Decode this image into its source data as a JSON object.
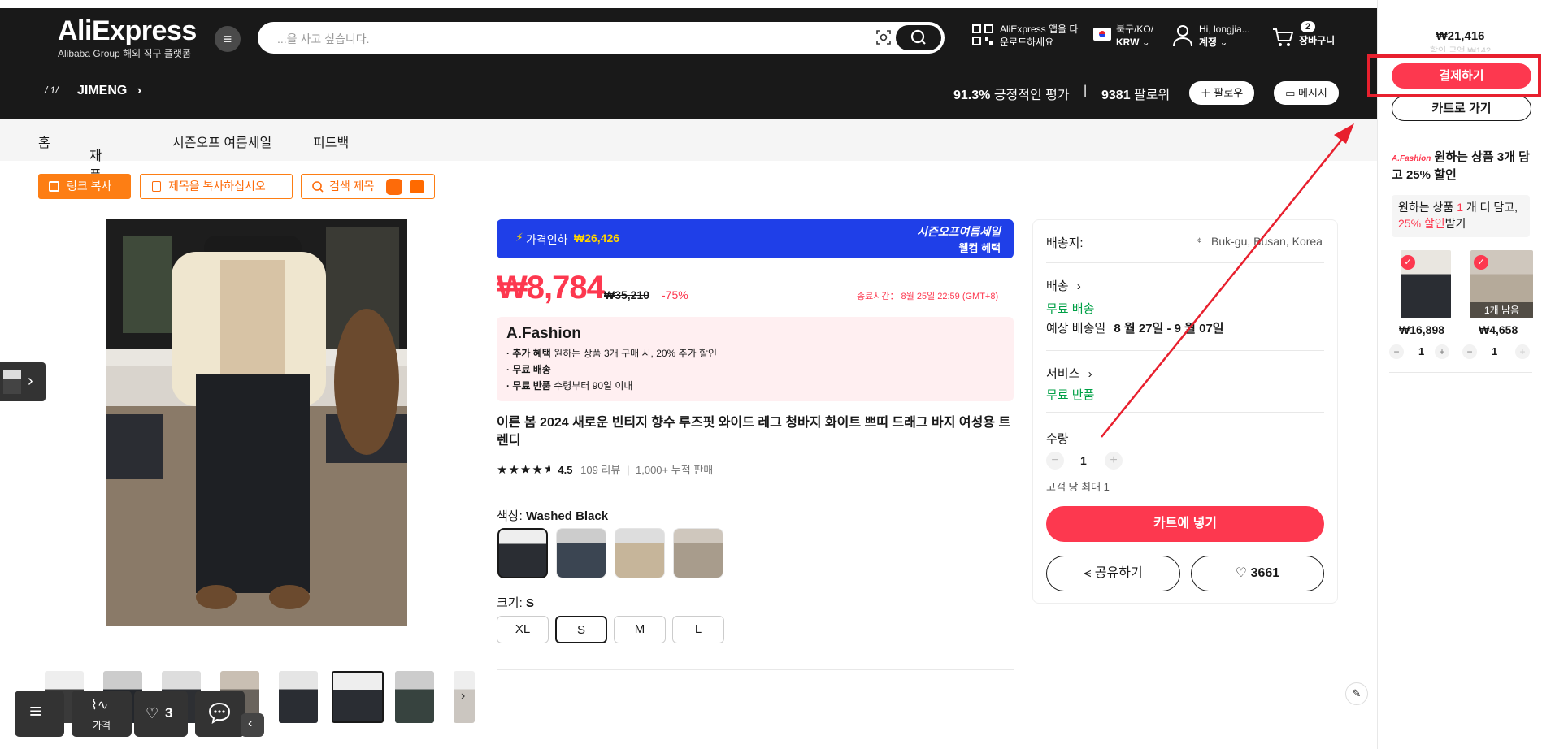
{
  "header": {
    "logo_main": "AliExpress",
    "logo_sub": "Alibaba Group 해외 직구 플랫폼",
    "search_placeholder": "...을 사고 싶습니다.",
    "app_line1": "AliExpress 앱을 다",
    "app_line2": "운로드하세요",
    "region_line1": "북구/KO/",
    "region_line2": "KRW",
    "account_line1": "Hi, longjia...",
    "account_line2": "계정",
    "cart_count": "2",
    "cart_label": "장바구니"
  },
  "store": {
    "name": "JIMENG",
    "logo_text": "/ 1/",
    "positive_rate": "91.3%",
    "positive_label": "긍정적인 평가",
    "separator": "|",
    "followers": "9381",
    "followers_label": "팔로워",
    "follow_btn": "팔로우",
    "message_btn": "메시지"
  },
  "nav": {
    "home": "홈",
    "products": "제품",
    "sale": "시즌오프 여름세일",
    "feedback": "피드백"
  },
  "tools": {
    "copy_link": "링크 복사",
    "copy_title": "제목을 복사하십시오",
    "search_title": "검색 제목"
  },
  "promo": {
    "price_drop_label": "가격인하",
    "price_drop_value": "₩26,426",
    "season_title": "시즌오프여름세일",
    "welcome": "웰컴 혜택"
  },
  "product": {
    "price": "₩8,784",
    "old_price": "₩35,210",
    "discount": "-75%",
    "end_time": "종료시간：  8월 25일 22:59 (GMT+8)",
    "fashion_brand": "A.Fashion",
    "benefit1_prefix": "· 추가 혜택",
    "benefit1_text": "원하는 상품 3개 구매 시, 20% 추가 할인",
    "benefit2_prefix": "· 무료 배송",
    "benefit3_prefix": "· 무료 반품",
    "benefit3_text": "수령부터 90일 이내",
    "title": "이른 봄 2024 새로운 빈티지 향수 루즈핏 와이드 레그 청바지 화이트 쁘띠 드래그 바지 여성용 트렌디",
    "rating": 4.5,
    "rating_text": "4.5",
    "reviews": "109 리뷰",
    "sold": "1,000+ 누적 판매",
    "color_label": "색상:",
    "color_value": "Washed Black",
    "size_label": "크기:",
    "size_value": "S",
    "sizes": [
      "XL",
      "S",
      "M",
      "L"
    ]
  },
  "shipping": {
    "ship_to_label": "배송지:",
    "ship_to_value": "Buk-gu, Busan, Korea",
    "delivery_label": "배송",
    "free_shipping": "무료 배송",
    "est_label": "예상 배송일",
    "est_value": "8 월 27일 - 9 월 07일",
    "service_label": "서비스",
    "free_return": "무료 반품",
    "qty_label": "수량",
    "qty_value": "1",
    "max_per_customer": "고객 당 최대 1",
    "add_to_cart": "카트에 넣기",
    "share": "공유하기",
    "wish_count": "3661"
  },
  "sidebar": {
    "total": "₩21,416",
    "discount_note": "할인 금액 ₩142",
    "checkout": "결제하기",
    "go_cart": "카트로 가기",
    "promo_brand": "A.Fashion",
    "promo_text": "원하는 상품 3개 담고 25% 할인",
    "more_prefix": "원하는 상품",
    "more_num": "1",
    "more_mid": "개 더 담고,",
    "more_pct": "25% 할인",
    "more_suffix": "받기",
    "items": [
      {
        "price": "₩16,898",
        "qty": "1",
        "note": ""
      },
      {
        "price": "₩4,658",
        "qty": "1",
        "note": "1개 남음"
      }
    ]
  },
  "floating": {
    "price_label": "가격",
    "wish_count": "3"
  },
  "colors": {
    "brand_red": "#fd384f",
    "header_bg": "#191919",
    "promo_blue": "#1f3fe8",
    "orange": "#fd7e14",
    "green": "#00a046",
    "annotation_red": "#e8202e"
  }
}
